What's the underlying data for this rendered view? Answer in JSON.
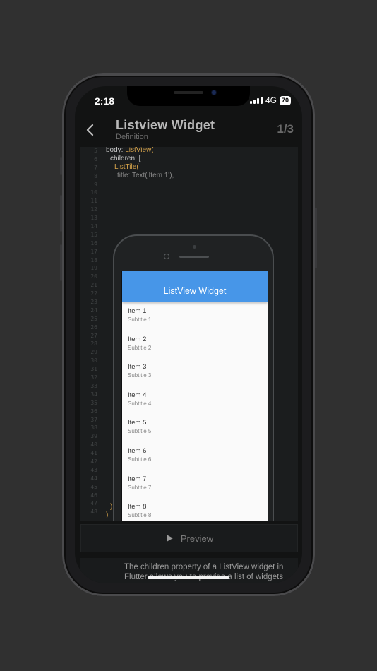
{
  "status_bar": {
    "time": "2:18",
    "network": "4G",
    "battery": "70"
  },
  "header": {
    "title": "Listview Widget",
    "subtitle": "Definition",
    "counter": "1/3"
  },
  "code": {
    "line1_plain": "body: ",
    "line1_kw": "ListView",
    "line1_end": "(",
    "line2": "children: [",
    "line3_kw": "ListTile",
    "line3_end": "(",
    "line4": "title: Text('Item 1'),",
    "close1": "]",
    "close2": ")",
    "close3": ")"
  },
  "preview": {
    "app_bar_title": "ListView Widget",
    "items": [
      {
        "title": "Item 1",
        "subtitle": "Subtitle 1"
      },
      {
        "title": "Item 2",
        "subtitle": "Subtitle 2"
      },
      {
        "title": "Item 3",
        "subtitle": "Subtitle 3"
      },
      {
        "title": "Item 4",
        "subtitle": "Subtitle 4"
      },
      {
        "title": "Item 5",
        "subtitle": "Subtitle 5"
      },
      {
        "title": "Item 6",
        "subtitle": "Subtitle 6"
      },
      {
        "title": "Item 7",
        "subtitle": "Subtitle 7"
      },
      {
        "title": "Item 8",
        "subtitle": "Subtitle 8"
      }
    ]
  },
  "preview_button": {
    "label": "Preview",
    "icon": "play-icon"
  },
  "description": {
    "text": "The children property of a ListView widget in Flutter allows you to provide a list of widgets that are scrolled..."
  },
  "colors": {
    "accent": "#4796e8",
    "keyword": "#d6a34a",
    "background": "#303030"
  }
}
